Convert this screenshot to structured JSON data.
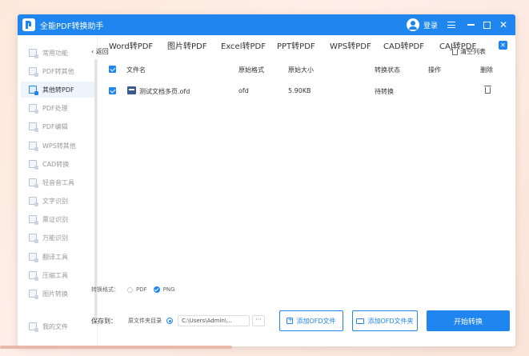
{
  "app": {
    "title": "全能PDF转换助手",
    "login_label": "登录"
  },
  "sidebar": {
    "items": [
      {
        "label": "常用功能"
      },
      {
        "label": "PDF转其他"
      },
      {
        "label": "其他转PDF"
      },
      {
        "label": "PDF处理"
      },
      {
        "label": "PDF编辑"
      },
      {
        "label": "WPS转其他"
      },
      {
        "label": "CAD转换"
      },
      {
        "label": "轻音音工具"
      },
      {
        "label": "文字识别"
      },
      {
        "label": "票证识别"
      },
      {
        "label": "万能识别"
      },
      {
        "label": "翻译工具"
      },
      {
        "label": "压缩工具"
      },
      {
        "label": "图片转换"
      }
    ],
    "my_files": "我的文件"
  },
  "tabs": [
    {
      "label": "Word转PDF"
    },
    {
      "label": "图片转PDF"
    },
    {
      "label": "Excel转PDF"
    },
    {
      "label": "PPT转PDF"
    },
    {
      "label": "WPS转PDF"
    },
    {
      "label": "CAD转PDF"
    },
    {
      "label": "CAJ转PDF"
    }
  ],
  "toolbar": {
    "back_label": "返回",
    "clear_label": "清空列表"
  },
  "table": {
    "headers": [
      "文件名",
      "原始格式",
      "原始大小",
      "转换状态",
      "操作",
      "删除"
    ],
    "rows": [
      {
        "name": "测试文档多页.ofd",
        "format": "ofd",
        "size": "5.90KB",
        "status": "待转换"
      }
    ]
  },
  "output": {
    "format_label": "转换格式：",
    "format_options": [
      "PDF",
      "PNG"
    ],
    "selected_format": "PNG",
    "save_label": "保存到：",
    "source_dir_label": "原文件夹目录",
    "path_value": "C:\\Users\\Admin\\...",
    "more_label": "···"
  },
  "buttons": {
    "add_file": "添加OFD文件",
    "add_folder": "添加OFD文件夹",
    "start": "开始转换"
  },
  "colors": {
    "accent": "#1f86f0",
    "background": "#fdeee7"
  }
}
